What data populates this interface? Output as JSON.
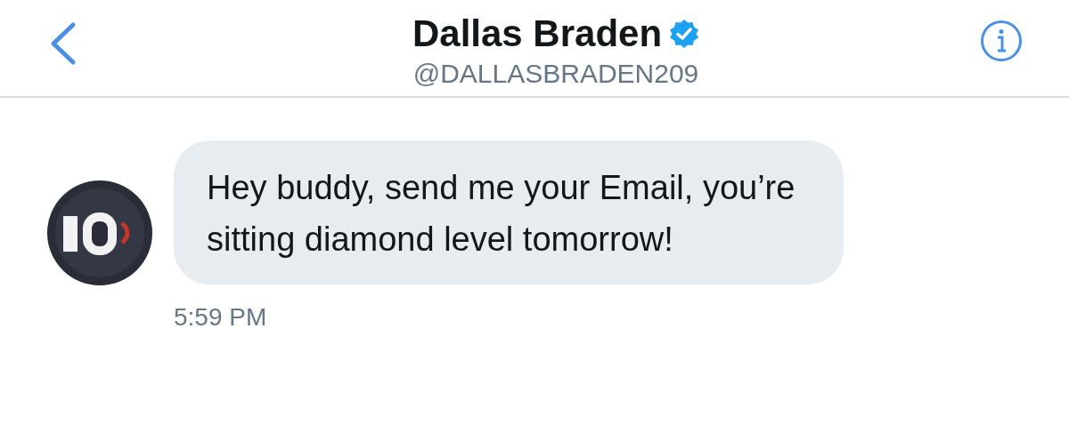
{
  "header": {
    "title": "Dallas Braden",
    "verified": true,
    "handle": "@DALLASBRADEN209"
  },
  "messages": [
    {
      "text": "Hey buddy, send me your Email, you’re sitting diamond level tomorrow!",
      "time": "5:59 PM"
    }
  ]
}
